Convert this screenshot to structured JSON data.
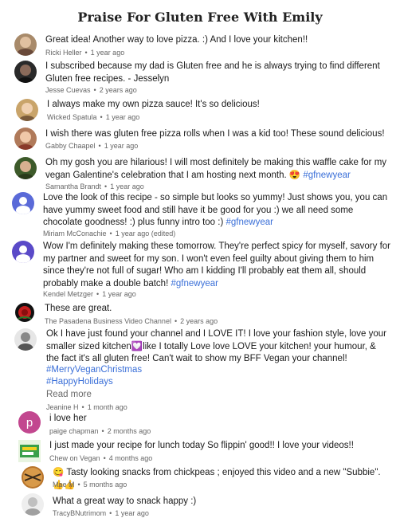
{
  "title": "Praise For Gluten Free With Emily",
  "comments": [
    {
      "text": "Great idea! Another way to love pizza. :) And I love your kitchen!!",
      "author": "Ricki Heller",
      "time": "1 year ago",
      "avatar": "photo-avatar",
      "color": "#a88a6a"
    },
    {
      "text": "I subscribed because my dad is Gluten free and he is always trying to find different Gluten free recipes. - Jesselyn",
      "author": "Jesse Cuevas",
      "time": "2 years ago",
      "avatar": "photo-avatar",
      "color": "#2a2a2a"
    },
    {
      "text": "I always make my own pizza sauce! It's so delicious!",
      "author": "Wicked Spatula",
      "time": "1 year ago",
      "avatar": "photo-avatar",
      "color": "#c9a46a"
    },
    {
      "text": "I wish there was gluten free pizza rolls when I was a kid too! These sound delicious!",
      "author": "Gabby Chaapel",
      "time": "1 year ago",
      "avatar": "photo-avatar",
      "color": "#b07a5a"
    },
    {
      "text": "Oh my gosh you are hilarious! I will most definitely be making this waffle cake for my vegan Galentine's celebration that I am hosting next month.",
      "emoji": "😍",
      "tag": "#gfnewyear",
      "author": "Samantha Brandt",
      "time": "1 year ago",
      "avatar": "photo-avatar",
      "color": "#3d5a2a"
    },
    {
      "text": "Love the look of this recipe - so simple but looks so yummy! Just shows you, you can have yummy sweet  food and still have it be good for you :) we all need some chocolate goodness! :) plus funny intro too :)",
      "tag": "#gfnewyear",
      "author": "Miriam McConachie",
      "time": "1 year ago (edited)",
      "avatar": "default-user-icon",
      "color": "#5a6ad8"
    },
    {
      "text": "Wow I'm definitely making these tomorrow. They're perfect spicy for myself, savory for my partner and sweet for my son. I won't even feel guilty about giving them to him since they're not full of sugar! Who am I kidding I'll probably eat them all, should probably make a double batch!",
      "tag": "#gfnewyear",
      "author": "Kendel Metzger",
      "time": "1 year ago",
      "avatar": "default-user-icon",
      "color": "#5a4ac8"
    },
    {
      "text": "These are great.",
      "author": "The Pasadena Business Video Channel",
      "time": "2 years ago",
      "avatar": "rose-logo-icon",
      "color": "#c41e1e"
    },
    {
      "text": "Ok I have just found your channel and I LOVE IT! I love your fashion style, love your smaller sized kitchen",
      "emoji_mid": "💟",
      "text2": "like I totally Love love LOVE your kitchen! your humour, & the fact it's all gluten free! Can't wait to show my BFF Vegan your channel!",
      "tags": [
        "#MerryVeganChristmas",
        "#HappyHolidays"
      ],
      "readmore": "Read more",
      "author": "Jeanine H",
      "time": "1 month ago",
      "avatar": "photo-avatar",
      "color": "#9a9a9a"
    },
    {
      "text": "i love her",
      "author": "paige chapman",
      "time": "2 months ago",
      "avatar": "letter-avatar",
      "letter": "p",
      "color": "#c2478f"
    },
    {
      "text": "I just made your recipe for lunch today So flippin' good!! I love your videos!!",
      "author": "Chew on Vegan",
      "time": "4 months ago",
      "avatar": "logo-avatar",
      "color": "#3aa04a"
    },
    {
      "text": "Tasty looking snacks from chickpeas ; enjoyed this video and a new \"Subbie\".",
      "emoji_pre": "😋",
      "emoji": "👍👍",
      "author": "Mae M",
      "time": "5 months ago",
      "avatar": "photo-avatar",
      "color": "#b8742a"
    },
    {
      "text": "What a great way to snack happy :)",
      "author": "TracyBNutrimom",
      "time": "1 year ago",
      "avatar": "photo-avatar",
      "color": "#d0d0d0"
    }
  ]
}
